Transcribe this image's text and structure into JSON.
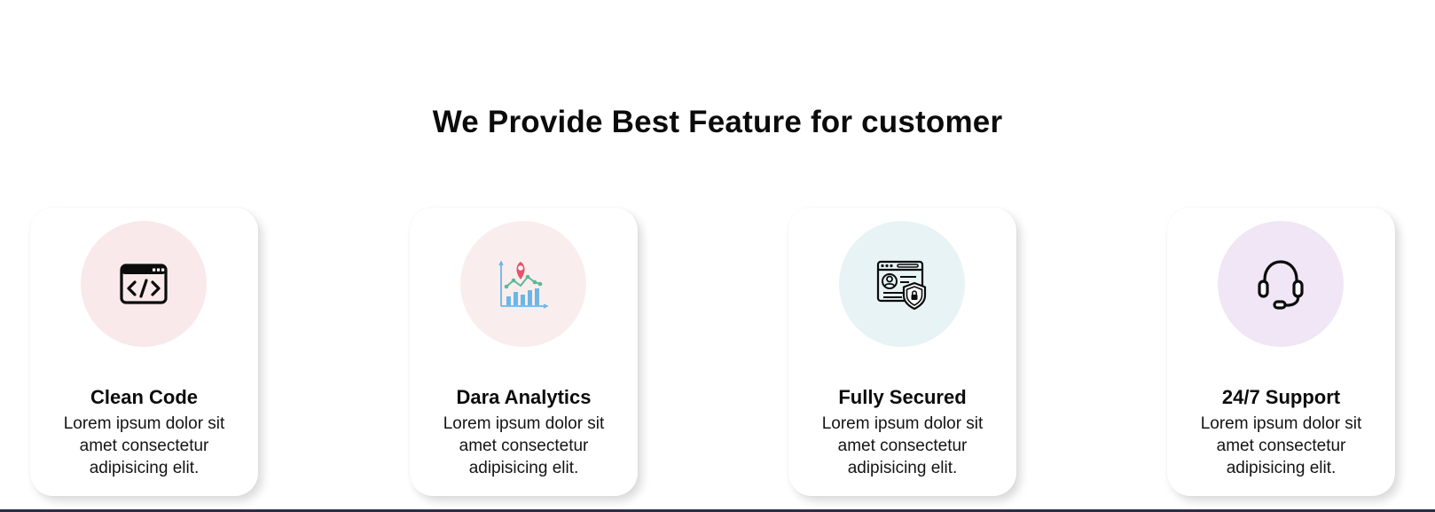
{
  "section": {
    "heading": "We Provide Best Feature for customer"
  },
  "features": [
    {
      "title": "Clean Code",
      "description": "Lorem ipsum dolor sit amet consectetur adipisicing elit.",
      "icon": "code-window-icon",
      "circle_color": "#f9e9ea"
    },
    {
      "title": "Dara Analytics",
      "description": "Lorem ipsum dolor sit amet consectetur adipisicing elit.",
      "icon": "analytics-chart-icon",
      "circle_color": "#f9eeed"
    },
    {
      "title": "Fully Secured",
      "description": "Lorem ipsum dolor sit amet consectetur adipisicing elit.",
      "icon": "secure-profile-shield-icon",
      "circle_color": "#e8f3f5"
    },
    {
      "title": "24/7 Support",
      "description": "Lorem ipsum dolor sit amet consectetur adipisicing elit.",
      "icon": "headset-icon",
      "circle_color": "#f1e6f5"
    }
  ],
  "colors": {
    "background": "#ffffff",
    "text": "#0b0b0b",
    "analytics_pin": "#e8506b",
    "analytics_bars": "#6cb6e6",
    "analytics_line": "#5bb89a",
    "footer_bar": "#2b2d4a"
  }
}
